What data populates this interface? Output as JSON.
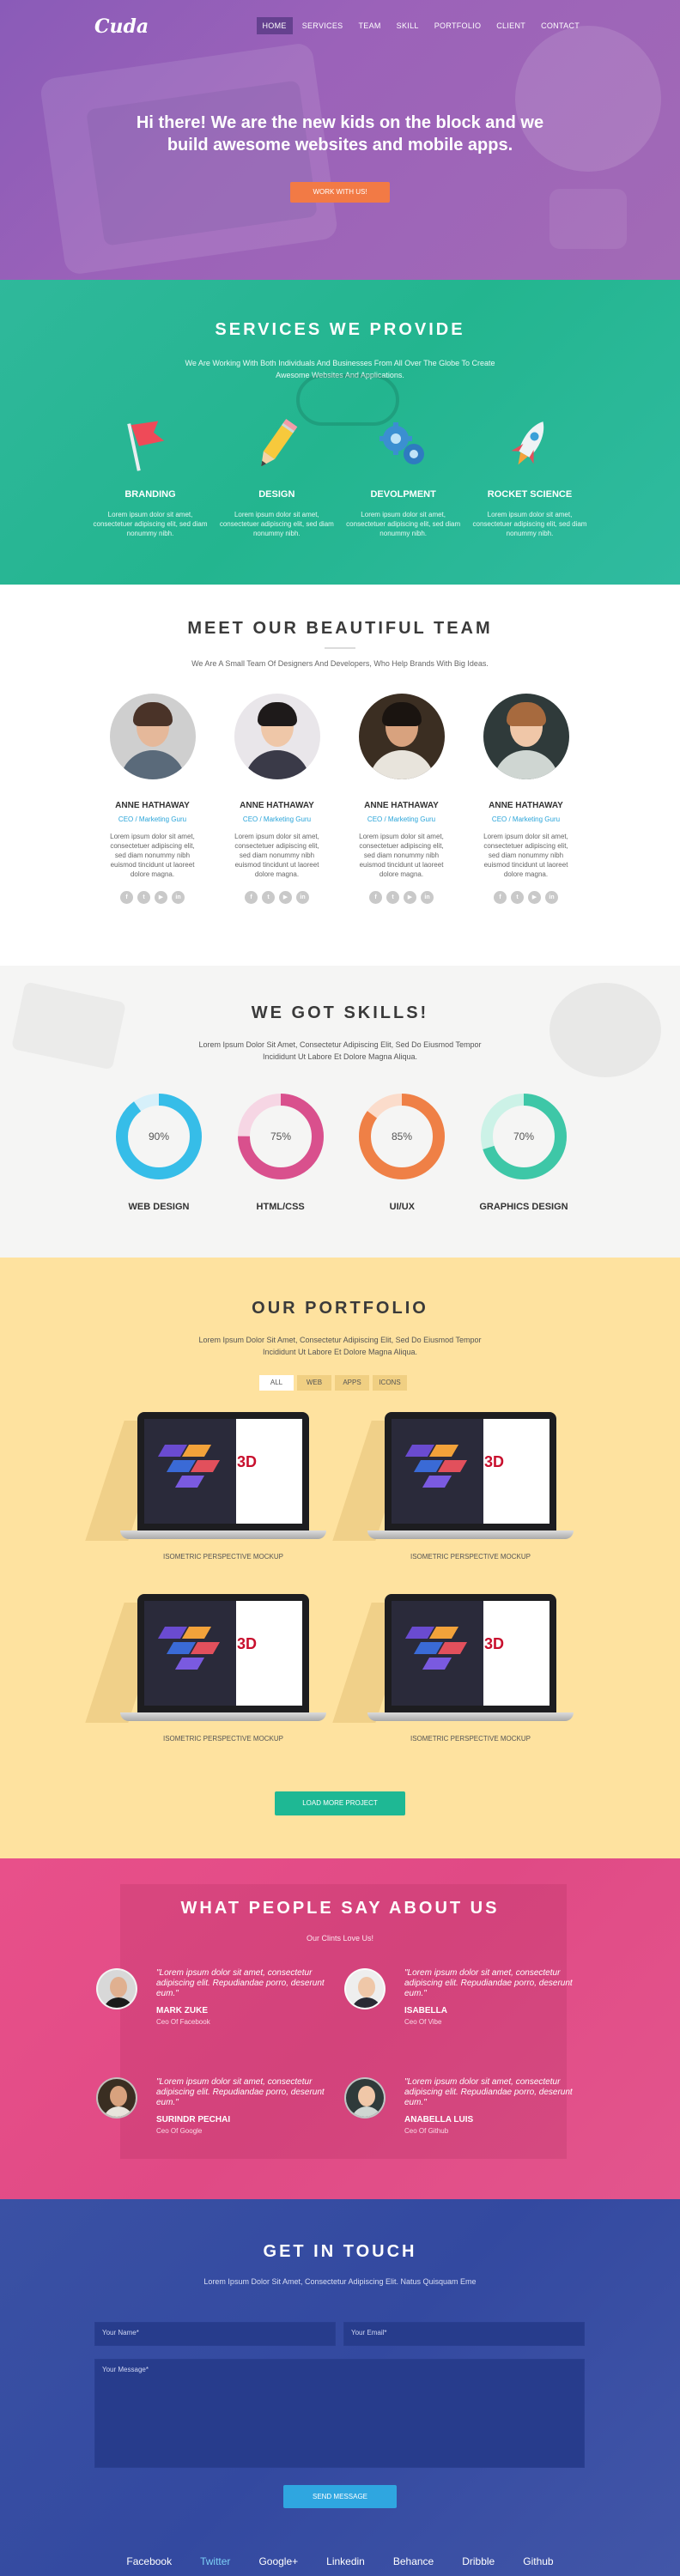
{
  "logo": "Cuda",
  "nav": [
    "HOME",
    "SERVICES",
    "TEAM",
    "SKILL",
    "PORTFOLIO",
    "CLIENT",
    "CONTACT"
  ],
  "hero": {
    "headline": "Hi there! We are the new kids on the block and we build awesome websites and mobile apps.",
    "cta": "WORK WITH US!"
  },
  "services": {
    "title": "SERVICES WE PROVIDE",
    "subtitle": "We Are Working With Both Individuals And Businesses From All Over The Globe To Create Awesome Websites And Applications.",
    "items": [
      {
        "name": "BRANDING",
        "icon": "flag-icon",
        "text": "Lorem ipsum dolor sit amet, consectetuer adipiscing elit, sed diam nonummy nibh."
      },
      {
        "name": "DESIGN",
        "icon": "pencil-icon",
        "text": "Lorem ipsum dolor sit amet, consectetuer adipiscing elit, sed diam nonummy nibh."
      },
      {
        "name": "DEVOLPMENT",
        "icon": "gears-icon",
        "text": "Lorem ipsum dolor sit amet, consectetuer adipiscing elit, sed diam nonummy nibh."
      },
      {
        "name": "ROCKET SCIENCE",
        "icon": "rocket-icon",
        "text": "Lorem ipsum dolor sit amet, consectetuer adipiscing elit, sed diam nonummy nibh."
      }
    ]
  },
  "team": {
    "title": "MEET OUR BEAUTIFUL TEAM",
    "subtitle": "We Are A Small Team Of Designers And Developers, Who Help Brands With Big Ideas.",
    "members": [
      {
        "name": "ANNE HATHAWAY",
        "role": "CEO / Marketing Guru",
        "bio": "Lorem ipsum dolor sit amet, consectetuer adipiscing elit, sed diam nonummy nibh euismod tincidunt ut laoreet dolore magna."
      },
      {
        "name": "ANNE HATHAWAY",
        "role": "CEO / Marketing Guru",
        "bio": "Lorem ipsum dolor sit amet, consectetuer adipiscing elit, sed diam nonummy nibh euismod tincidunt ut laoreet dolore magna."
      },
      {
        "name": "ANNE HATHAWAY",
        "role": "CEO / Marketing Guru",
        "bio": "Lorem ipsum dolor sit amet, consectetuer adipiscing elit, sed diam nonummy nibh euismod tincidunt ut laoreet dolore magna."
      },
      {
        "name": "ANNE HATHAWAY",
        "role": "CEO / Marketing Guru",
        "bio": "Lorem ipsum dolor sit amet, consectetuer adipiscing elit, sed diam nonummy nibh euismod tincidunt ut laoreet dolore magna."
      }
    ],
    "social_icons": [
      "facebook-icon",
      "twitter-icon",
      "youtube-icon",
      "linkedin-icon"
    ]
  },
  "skills": {
    "title": "WE GOT SKILLS!",
    "subtitle": "Lorem Ipsum Dolor Sit Amet, Consectetur Adipiscing Elit, Sed Do Eiusmod Tempor Incididunt Ut Labore Et Dolore Magna Aliqua.",
    "items": [
      {
        "name": "WEB DESIGN",
        "percent": 90,
        "label": "90%",
        "color": "#36bde8",
        "track": "#d6f0fa"
      },
      {
        "name": "HTML/CSS",
        "percent": 75,
        "label": "75%",
        "color": "#d9508d",
        "track": "#f6d6e4"
      },
      {
        "name": "UI/UX",
        "percent": 85,
        "label": "85%",
        "color": "#ef8046",
        "track": "#fbdccb"
      },
      {
        "name": "GRAPHICS DESIGN",
        "percent": 70,
        "label": "70%",
        "color": "#3ec7a7",
        "track": "#ccf2e7"
      }
    ]
  },
  "portfolio": {
    "title": "OUR PORTFOLIO",
    "subtitle": "Lorem Ipsum Dolor Sit Amet, Consectetur Adipiscing Elit, Sed Do Eiusmod Tempor Incididunt Ut Labore Et Dolore Magna Aliqua.",
    "filters": [
      "ALL",
      "WEB",
      "APPS",
      "ICONS"
    ],
    "items": [
      {
        "caption": "ISOMETRIC PERSPECTIVE MOCKUP"
      },
      {
        "caption": "ISOMETRIC PERSPECTIVE MOCKUP"
      },
      {
        "caption": "ISOMETRIC PERSPECTIVE MOCKUP"
      },
      {
        "caption": "ISOMETRIC PERSPECTIVE MOCKUP"
      }
    ],
    "load_more": "LOAD MORE PROJECT"
  },
  "testimonials": {
    "title": "WHAT PEOPLE SAY ABOUT US",
    "subtitle": "Our Clints Love Us!",
    "items": [
      {
        "quote": "\"Lorem ipsum dolor sit amet, consectetur adipiscing elit. Repudiandae porro, deserunt eum.\"",
        "name": "MARK ZUKE",
        "position": "Ceo Of Facebook"
      },
      {
        "quote": "\"Lorem ipsum dolor sit amet, consectetur adipiscing elit. Repudiandae porro, deserunt eum.\"",
        "name": "ISABELLA",
        "position": "Ceo Of Vibe"
      },
      {
        "quote": "\"Lorem ipsum dolor sit amet, consectetur adipiscing elit. Repudiandae porro, deserunt eum.\"",
        "name": "SURINDR PECHAI",
        "position": "Ceo Of Google"
      },
      {
        "quote": "\"Lorem ipsum dolor sit amet, consectetur adipiscing elit. Repudiandae porro, deserunt eum.\"",
        "name": "ANABELLA LUIS",
        "position": "Ceo Of Github"
      }
    ]
  },
  "contact": {
    "title": "GET IN TOUCH",
    "subtitle": "Lorem Ipsum Dolor Sit Amet, Consectetur Adipiscing Elit. Natus Quisquam Eme",
    "name_placeholder": "Your Name*",
    "email_placeholder": "Your Email*",
    "message_placeholder": "Your Message*",
    "send": "SEND MESSAGE"
  },
  "footer": [
    "Facebook",
    "Twitter",
    "Google+",
    "Linkedin",
    "Behance",
    "Dribble",
    "Github"
  ]
}
